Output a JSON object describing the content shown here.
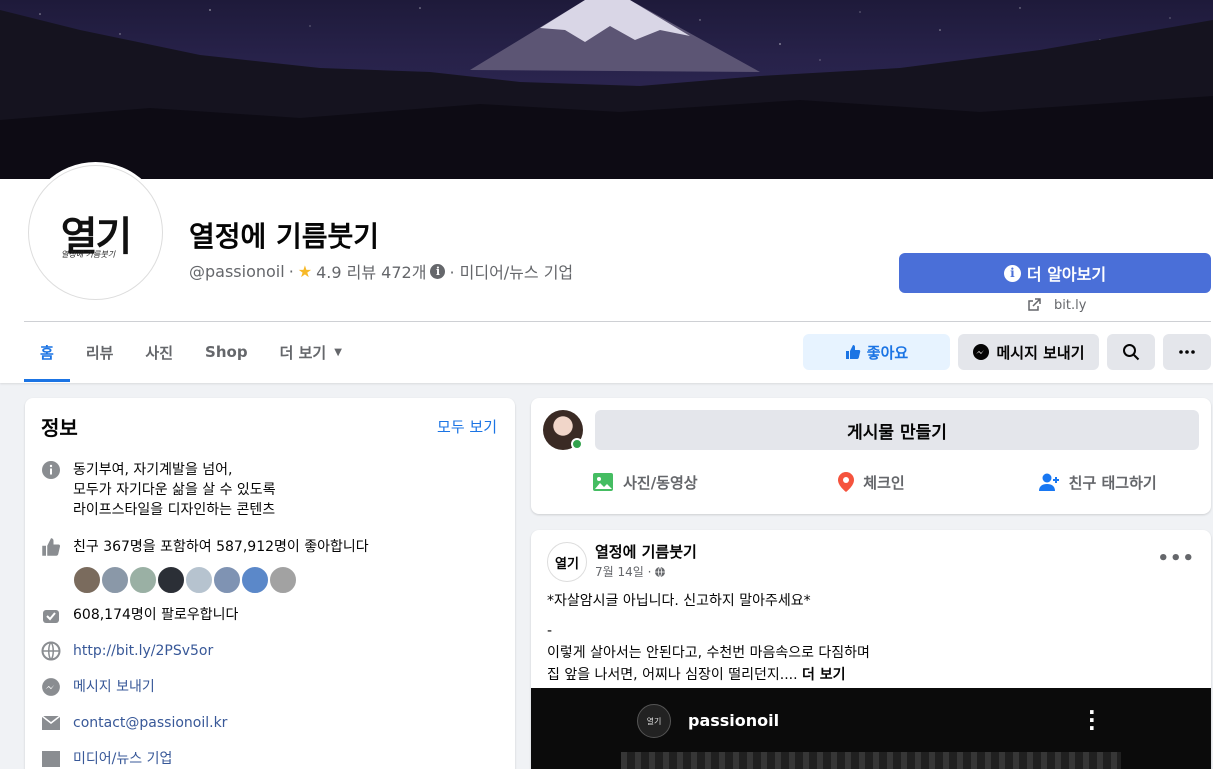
{
  "page": {
    "name": "열정에 기름붓기",
    "handle": "@passionoil",
    "separator": "·",
    "rating": "4.9 리뷰 472개",
    "category": "· 미디어/뉴스 기업",
    "logo_text": "열기",
    "logo_sub": "열정에 기름붓기"
  },
  "header": {
    "learn_more": "더 알아보기",
    "website": "bit.ly"
  },
  "tabs": [
    {
      "label": "홈"
    },
    {
      "label": "리뷰"
    },
    {
      "label": "사진"
    },
    {
      "label": "Shop"
    },
    {
      "label": "더 보기"
    }
  ],
  "actions": {
    "like": "좋아요",
    "message": "메시지 보내기"
  },
  "info": {
    "title": "정보",
    "see_all": "모두 보기",
    "description": [
      "동기부여, 자기계발을 넘어,",
      "모두가 자기다운 삶을 살 수 있도록",
      "라이프스타일을 디자인하는 콘텐츠"
    ],
    "likes": "친구 367명을 포함하여 587,912명이 좋아합니다",
    "followers": "608,174명이 팔로우합니다",
    "link": "http://bit.ly/2PSv5or",
    "message": "메시지 보내기",
    "email": "contact@passionoil.kr",
    "category": "미디어/뉴스 기업"
  },
  "friend_colors": [
    "#7a6b5d",
    "#8a98a8",
    "#9ab0a4",
    "#2b2f36",
    "#b6c3cf",
    "#7f93b3",
    "#5b88c9",
    "#a2a2a2"
  ],
  "create_post": {
    "prompt": "게시물 만들기",
    "photo": "사진/동영상",
    "checkin": "체크인",
    "tag": "친구 태그하기"
  },
  "post": {
    "author": "열정에 기름붓기",
    "date": "7월 14일 ·",
    "line1": "*자살암시글 아닙니다. 신고하지 말아주세요*",
    "line2": "-",
    "line3": "이렇게 살아서는 안된다고, 수천번 마음속으로 다짐하며",
    "line4": "집 앞을 나서면, 어찌나 심장이 떨리던지....",
    "see_more": "더 보기",
    "media_account": "passionoil",
    "avatar_text": "열기"
  },
  "colors": {
    "accent": "#1b74e4",
    "learn_more_bg": "#4a6fd8",
    "online": "#31a24c"
  }
}
